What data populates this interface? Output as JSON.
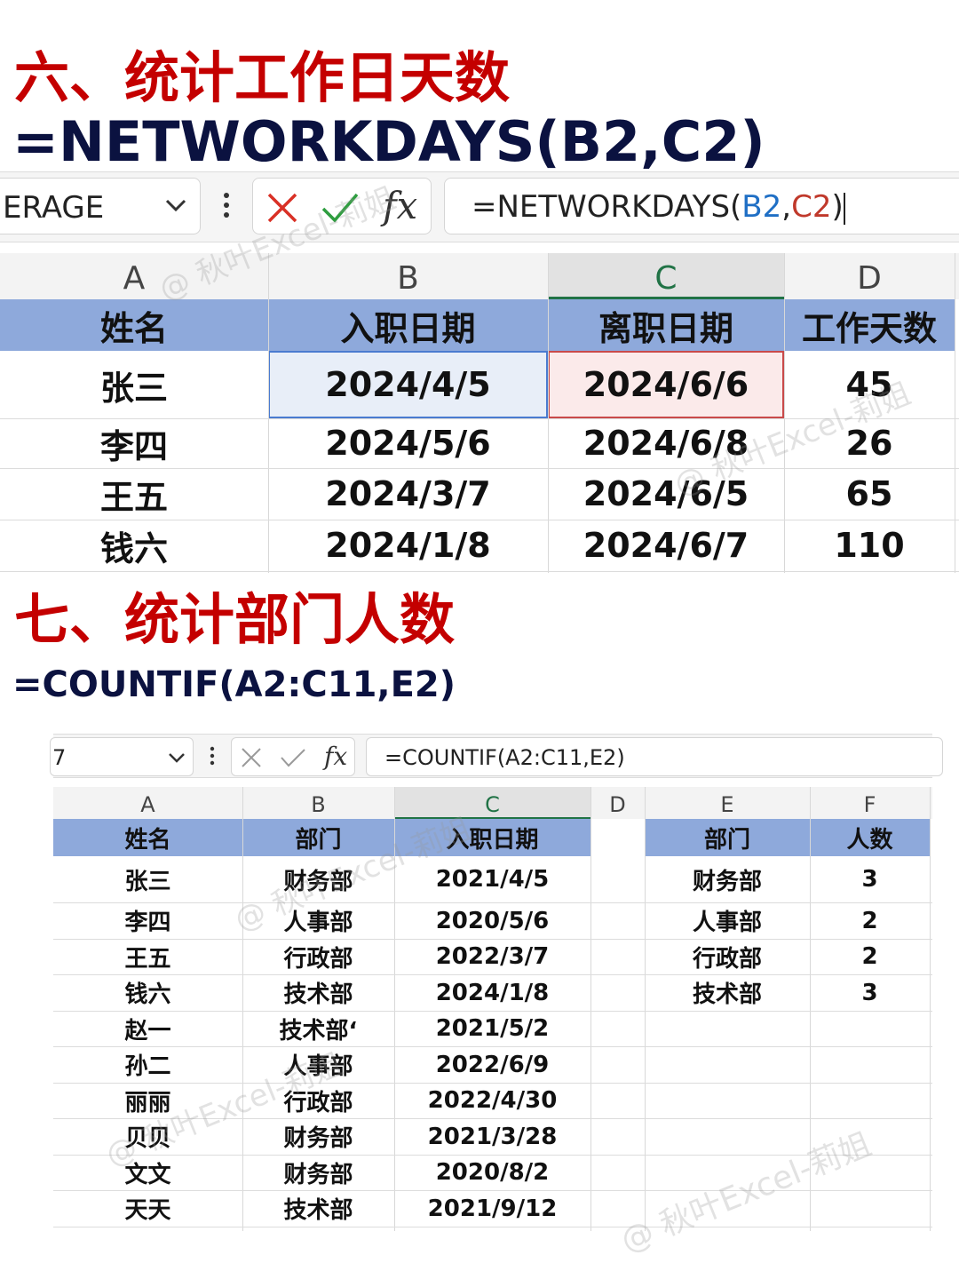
{
  "section1": {
    "title": "六、统计工作日天数",
    "formula_heading": "=NETWORKDAYS(B2,C2)",
    "name_box": "ERAGE",
    "formula_bar": {
      "prefix": "=NETWORKDAYS(",
      "arg1": "B2",
      "sep": ",",
      "arg2": "C2",
      "suffix": ")"
    },
    "columns": [
      "A",
      "B",
      "C",
      "D"
    ],
    "headers": [
      "姓名",
      "入职日期",
      "离职日期",
      "工作天数"
    ],
    "rows": [
      [
        "张三",
        "2024/4/5",
        "2024/6/6",
        "45"
      ],
      [
        "李四",
        "2024/5/6",
        "2024/6/8",
        "26"
      ],
      [
        "王五",
        "2024/3/7",
        "2024/6/5",
        "65"
      ],
      [
        "钱六",
        "2024/1/8",
        "2024/6/7",
        "110"
      ]
    ]
  },
  "section2": {
    "title": "七、统计部门人数",
    "formula_heading": "=COUNTIF(A2:C11,E2)",
    "name_box": "7",
    "formula_bar": "=COUNTIF(A2:C11,E2)",
    "columns": [
      "A",
      "B",
      "C",
      "D",
      "E",
      "F"
    ],
    "headers": [
      "姓名",
      "部门",
      "入职日期"
    ],
    "rows": [
      [
        "张三",
        "财务部",
        "2021/4/5"
      ],
      [
        "李四",
        "人事部",
        "2020/5/6"
      ],
      [
        "王五",
        "行政部",
        "2022/3/7"
      ],
      [
        "钱六",
        "技术部",
        "2024/1/8"
      ],
      [
        "赵一",
        "技术部‘",
        "2021/5/2"
      ],
      [
        "孙二",
        "人事部",
        "2022/6/9"
      ],
      [
        "丽丽",
        "行政部",
        "2022/4/30"
      ],
      [
        "贝贝",
        "财务部",
        "2021/3/28"
      ],
      [
        "文文",
        "财务部",
        "2020/8/2"
      ],
      [
        "天天",
        "技术部",
        "2021/9/12"
      ]
    ],
    "summary_headers": [
      "部门",
      "人数"
    ],
    "summary_rows": [
      [
        "财务部",
        "3"
      ],
      [
        "人事部",
        "2"
      ],
      [
        "行政部",
        "2"
      ],
      [
        "技术部",
        "3"
      ]
    ]
  },
  "watermark": "@ 秋叶Excel-莉姐",
  "colors": {
    "title_red": "#c40000",
    "header_fill": "#8ea9db",
    "accent_green": "#217346",
    "arg_blue": "#1f6fc5",
    "arg_red": "#c0392b"
  }
}
